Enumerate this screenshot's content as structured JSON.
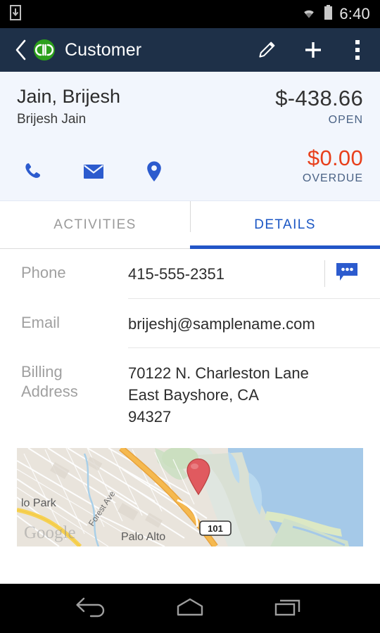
{
  "status_bar": {
    "time": "6:40",
    "icons": [
      "download-icon",
      "wifi-icon",
      "battery-icon"
    ]
  },
  "app_bar": {
    "back_icon": "back-chevron-icon",
    "logo": "quickbooks-logo",
    "logo_text": "qb",
    "title": "Customer",
    "actions": [
      {
        "name": "edit-button",
        "icon": "pencil-icon"
      },
      {
        "name": "add-button",
        "icon": "plus-icon"
      },
      {
        "name": "overflow-menu-button",
        "icon": "more-vertical-icon"
      }
    ],
    "background": "#1e3048"
  },
  "summary": {
    "customer_title": "Jain, Brijesh",
    "customer_subtitle": "Brijesh Jain",
    "balance_amount": "$-438.66",
    "balance_label": "OPEN",
    "overdue_amount": "$0.00",
    "overdue_label": "OVERDUE",
    "overdue_color": "#e8401c",
    "background": "#f2f6fd",
    "quick_actions": [
      {
        "name": "call-button",
        "icon": "phone-icon"
      },
      {
        "name": "email-button",
        "icon": "envelope-icon"
      },
      {
        "name": "map-button",
        "icon": "location-pin-icon"
      }
    ],
    "action_color": "#2c5bce"
  },
  "tabs": {
    "items": [
      {
        "label": "ACTIVITIES",
        "active": false
      },
      {
        "label": "DETAILS",
        "active": true
      }
    ],
    "active_color": "#1a56c4",
    "inactive_color": "#9a9a9a"
  },
  "details": {
    "phone": {
      "label": "Phone",
      "value": "415-555-2351",
      "message_icon": "message-bubble-icon"
    },
    "email": {
      "label": "Email",
      "value": "brijeshj@samplename.com"
    },
    "billing_address": {
      "label": "Billing\nAddress",
      "label_line1": "Billing",
      "label_line2": "Address",
      "line1": "70122 N. Charleston Lane",
      "line2": "East Bayshore,  CA",
      "line3": "94327"
    }
  },
  "map": {
    "labels": {
      "menlo_park": "lo Park",
      "forest_ave": "Forest Ave",
      "palo_alto": "Palo Alto",
      "highway": "101",
      "attribution": "Google"
    },
    "pin_color": "#e05a5f",
    "water_color": "#a5c9e8",
    "land_color": "#e8e3db",
    "highway_color": "#f5a623"
  },
  "nav_bar": {
    "buttons": [
      {
        "name": "nav-back-button",
        "icon": "back-arrow-icon"
      },
      {
        "name": "nav-home-button",
        "icon": "home-icon"
      },
      {
        "name": "nav-recents-button",
        "icon": "recents-icon"
      }
    ]
  }
}
